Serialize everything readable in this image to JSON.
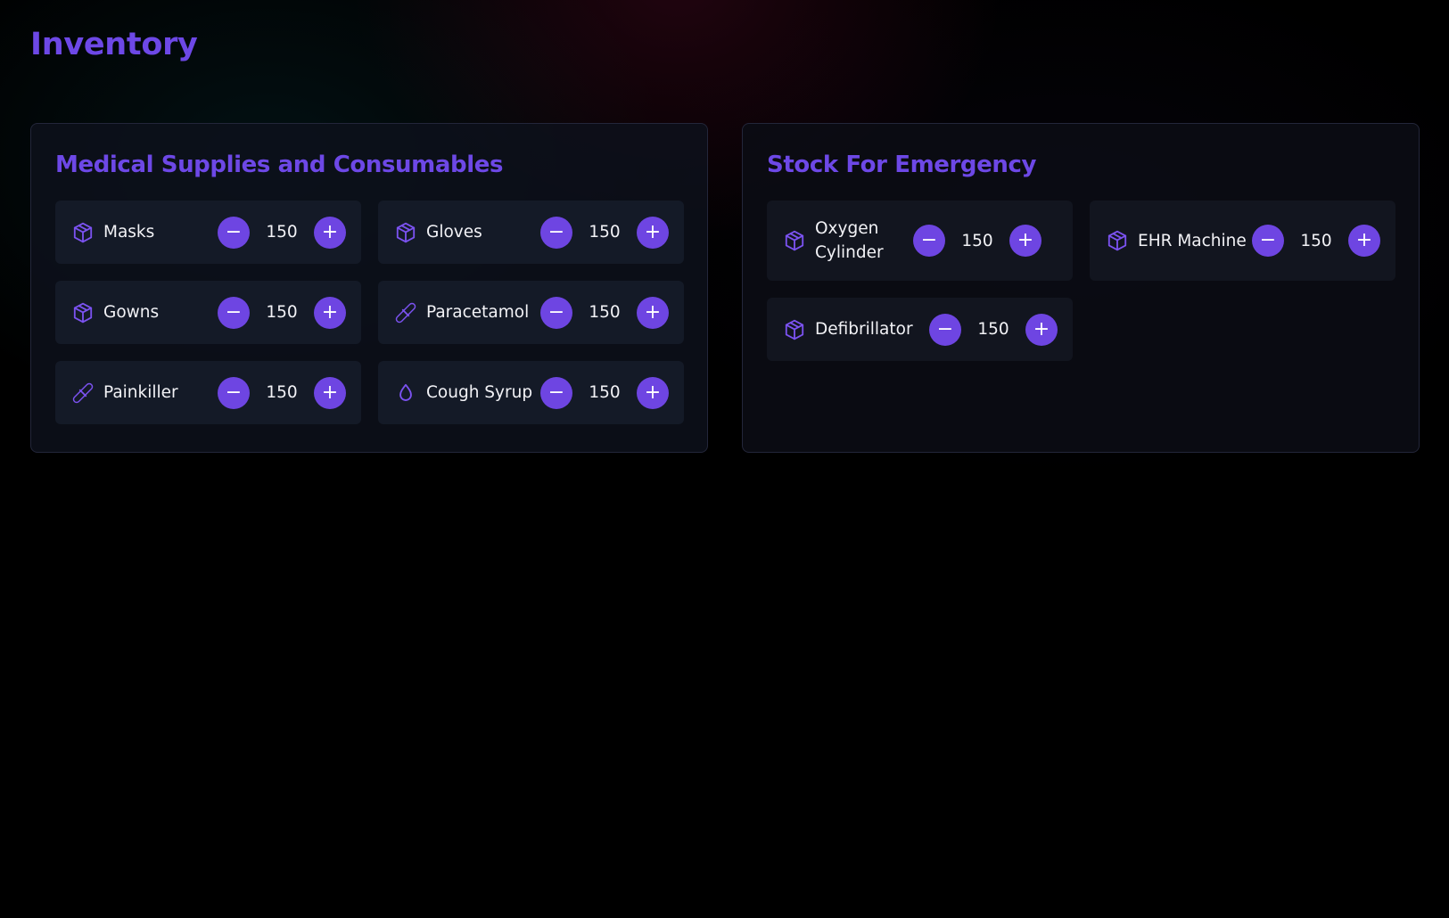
{
  "header": {
    "title": "Inventory"
  },
  "panels": {
    "medical": {
      "title": "Medical Supplies and Consumables",
      "items": [
        {
          "label": "Masks",
          "qty": "150",
          "icon": "box-icon"
        },
        {
          "label": "Gloves",
          "qty": "150",
          "icon": "box-icon"
        },
        {
          "label": "Gowns",
          "qty": "150",
          "icon": "box-icon"
        },
        {
          "label": "Paracetamol",
          "qty": "150",
          "icon": "pill-icon"
        },
        {
          "label": "Painkiller",
          "qty": "150",
          "icon": "pill-icon"
        },
        {
          "label": "Cough Syrup",
          "qty": "150",
          "icon": "droplet-icon"
        }
      ]
    },
    "emergency": {
      "title": "Stock For Emergency",
      "items": [
        {
          "label": "Oxygen Cylinder",
          "qty": "150",
          "icon": "box-icon"
        },
        {
          "label": "EHR Machine",
          "qty": "150",
          "icon": "box-icon"
        },
        {
          "label": "Defibrillator",
          "qty": "150",
          "icon": "box-icon"
        }
      ]
    }
  },
  "controls": {
    "decrement": "−",
    "increment": "+"
  },
  "colors": {
    "accent": "#6d48e6",
    "button": "#6e45e2",
    "card": "#141a27",
    "text": "#f2f2f6"
  }
}
